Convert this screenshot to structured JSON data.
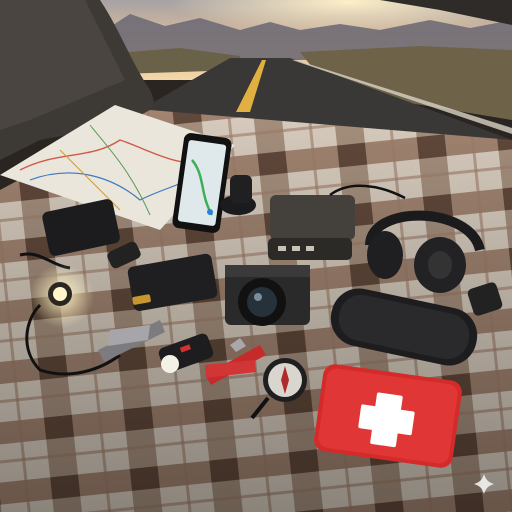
{
  "scene": {
    "description_items": [
      "road-map",
      "smartphone-gps",
      "phone-mount",
      "power-bank-hub",
      "car-charger",
      "headphones",
      "camera",
      "power-bank",
      "bluetooth-speaker",
      "multi-tool",
      "flashlight",
      "compass",
      "first-aid-kit",
      "headlamp",
      "remote-control"
    ],
    "colors": {
      "sky_top": "#c9a98a",
      "sun_glow": "#f7d9a0",
      "mountains": "#6b6a74",
      "road": "#3a3836",
      "road_line": "#e0b040",
      "blanket_cream": "#d8cfc2",
      "blanket_brown": "#8a6a55",
      "blanket_dark": "#5b4334",
      "first_aid_red": "#d42a2a",
      "device_black": "#1c1c1e"
    }
  }
}
